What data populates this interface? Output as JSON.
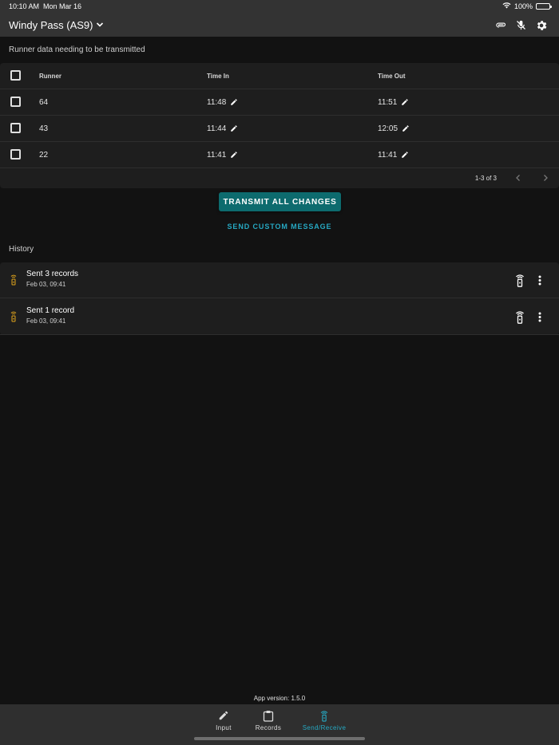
{
  "status": {
    "time": "10:10 AM",
    "date": "Mon Mar 16",
    "battery": "100%"
  },
  "header": {
    "title": "Windy Pass (AS9)"
  },
  "pending": {
    "label": "Runner data needing to be transmitted",
    "columns": {
      "runner": "Runner",
      "time_in": "Time In",
      "time_out": "Time Out"
    },
    "rows": [
      {
        "runner": "64",
        "time_in": "11:48",
        "time_out": "11:51"
      },
      {
        "runner": "43",
        "time_in": "11:44",
        "time_out": "12:05"
      },
      {
        "runner": "22",
        "time_in": "11:41",
        "time_out": "11:41"
      }
    ],
    "pagination": "1-3 of 3"
  },
  "actions": {
    "transmit": "TRANSMIT ALL CHANGES",
    "custom": "SEND CUSTOM MESSAGE"
  },
  "history": {
    "label": "History",
    "items": [
      {
        "title": "Sent 3 records",
        "date": "Feb 03, 09:41"
      },
      {
        "title": "Sent 1 record",
        "date": "Feb 03, 09:41"
      }
    ]
  },
  "footer": {
    "version": "App version: 1.5.0"
  },
  "nav": {
    "input": "Input",
    "records": "Records",
    "send_receive": "Send/Receive"
  },
  "colors": {
    "accent": "#26a8c2",
    "primary_button": "#0d6b6e",
    "history_icon": "#e0a41c"
  }
}
